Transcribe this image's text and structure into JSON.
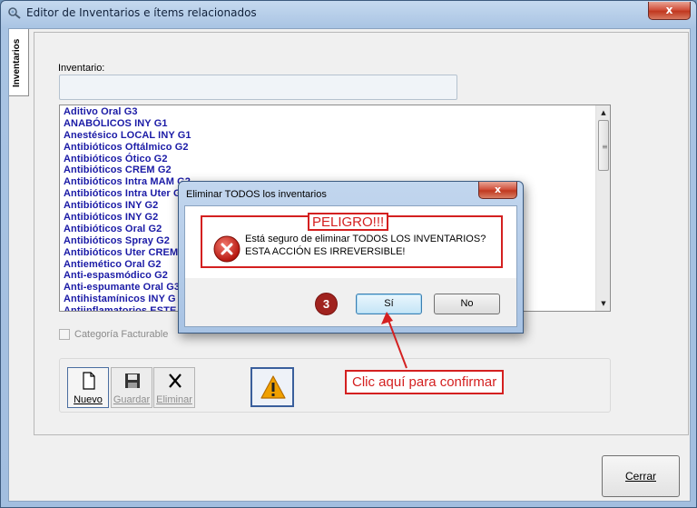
{
  "window": {
    "title": "Editor de Inventarios e ítems relacionados",
    "close_glyph": "x"
  },
  "side_tab": {
    "label": "Inventarios"
  },
  "form": {
    "inventario_label": "Inventario:",
    "inventario_value": "",
    "list": {
      "items": [
        "Aditivo Oral G3",
        "ANABÓLICOS INY G1",
        "Anestésico LOCAL INY G1",
        "Antibióticos  Oftálmico G2",
        "Antibióticos  Ótico G2",
        "Antibióticos CREM G2",
        "Antibióticos Intra MAM G2",
        "Antibióticos Intra Uter G",
        "Antibióticos INY  G2",
        "Antibióticos INY G2",
        "Antibióticos Oral G2",
        "Antibióticos Spray G2",
        "Antibióticos Uter CREM",
        "Antiemético Oral G2",
        "Anti-espasmódico G2",
        "Anti-espumante Oral G3",
        "Antihistamínicos INY G",
        "Antiinflamatorios ESTE"
      ]
    },
    "categoria_facturable_label": "Categoría Facturable",
    "categoria_facturable_checked": false
  },
  "toolbar": {
    "nuevo_label": "Nuevo",
    "guardar_label": "Guardar",
    "eliminar_label": "Eliminar"
  },
  "footer": {
    "cerrar_label": "Cerrar"
  },
  "dialog": {
    "title": "Eliminar TODOS los inventarios",
    "close_glyph": "x",
    "badge": "PELIGRO!!!",
    "message_line1": "Está seguro de eliminar TODOS LOS INVENTARIOS?",
    "message_line2": "ESTA ACCIÓN ES IRREVERSIBLE!",
    "yes_label": "Sí",
    "no_label": "No"
  },
  "annotations": {
    "step_number": "3",
    "callout_text": "Clic aquí para confirmar",
    "accent_color": "#d42020"
  },
  "icons": [
    "app-icon",
    "close-icon",
    "scroll-up-icon",
    "scroll-down-icon",
    "new-document-icon",
    "save-icon",
    "delete-x-icon",
    "warning-icon",
    "error-icon"
  ]
}
